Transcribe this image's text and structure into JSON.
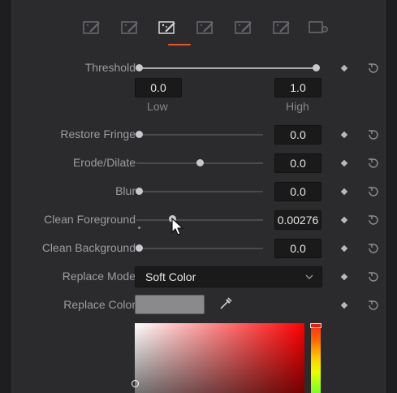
{
  "tabs": [
    {
      "icon": "qualifier-icon"
    },
    {
      "icon": "qualifier-icon"
    },
    {
      "icon": "matte-finesse-icon",
      "active": true
    },
    {
      "icon": "qualifier-icon"
    },
    {
      "icon": "qualifier-icon"
    },
    {
      "icon": "qualifier-icon"
    },
    {
      "icon": "settings-icon"
    }
  ],
  "colors": {
    "accent": "#e8532d",
    "panel": "#2b2b2e",
    "field": "#1a1a1b"
  },
  "threshold": {
    "label": "Threshold",
    "low_value": "0.0",
    "high_value": "1.0",
    "low_label": "Low",
    "high_label": "High",
    "low_level": 0.0,
    "high_level": 1.0
  },
  "restore_fringe": {
    "label": "Restore Fringe",
    "value": "0.0",
    "level": 0.0
  },
  "erode_dilate": {
    "label": "Erode/Dilate",
    "value": "0.0",
    "level": 0.5
  },
  "blur": {
    "label": "Blur",
    "value": "0.0",
    "level": 0.0
  },
  "clean_foreground": {
    "label": "Clean Foreground",
    "value": "0.00276",
    "level": 0.29
  },
  "clean_background": {
    "label": "Clean Background",
    "value": "0.0",
    "level": 0.0
  },
  "replace_mode": {
    "label": "Replace Mode",
    "value": "Soft Color"
  },
  "replace_color": {
    "label": "Replace Color",
    "swatch": "#8a8a8d"
  }
}
